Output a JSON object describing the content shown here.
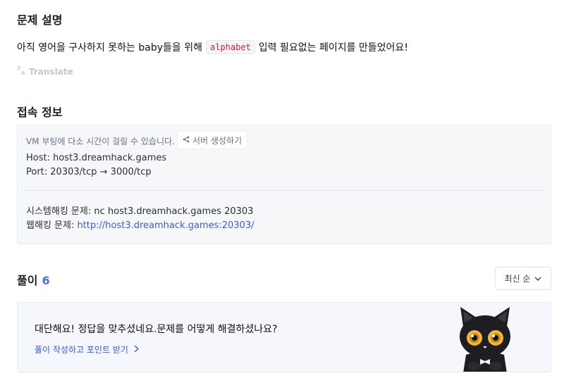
{
  "problem": {
    "heading": "문제 설명",
    "desc_before": "아직 영어을 구사하지 못하는 baby들을 위해",
    "desc_code": "alphabet",
    "desc_after": "입력 필요없는 페이지를 만들었어요!",
    "translate_label": "Translate"
  },
  "connection": {
    "heading": "접속 정보",
    "vm_note": "VM 부팅에 다소 시간이 걸릴 수 있습니다.",
    "server_button": "서버 생성하기",
    "host_line": "Host: host3.dreamhack.games",
    "port_line": "Port:  20303/tcp → 3000/tcp",
    "system_line": "시스템해킹 문제: nc host3.dreamhack.games 20303",
    "web_label": "웹해킹 문제:",
    "web_url": "http://host3.dreamhack.games:20303/"
  },
  "solutions": {
    "heading": "풀이",
    "count": "6",
    "sort_label": "최신 순",
    "cta_text": "대단해요! 정답을 맞추셨네요.문제를 어떻게 해결하셨나요?",
    "cta_link": "풀이 작성하고 포인트 받기"
  },
  "colors": {
    "accent": "#3b5bdb",
    "code_text": "#c7254e"
  }
}
